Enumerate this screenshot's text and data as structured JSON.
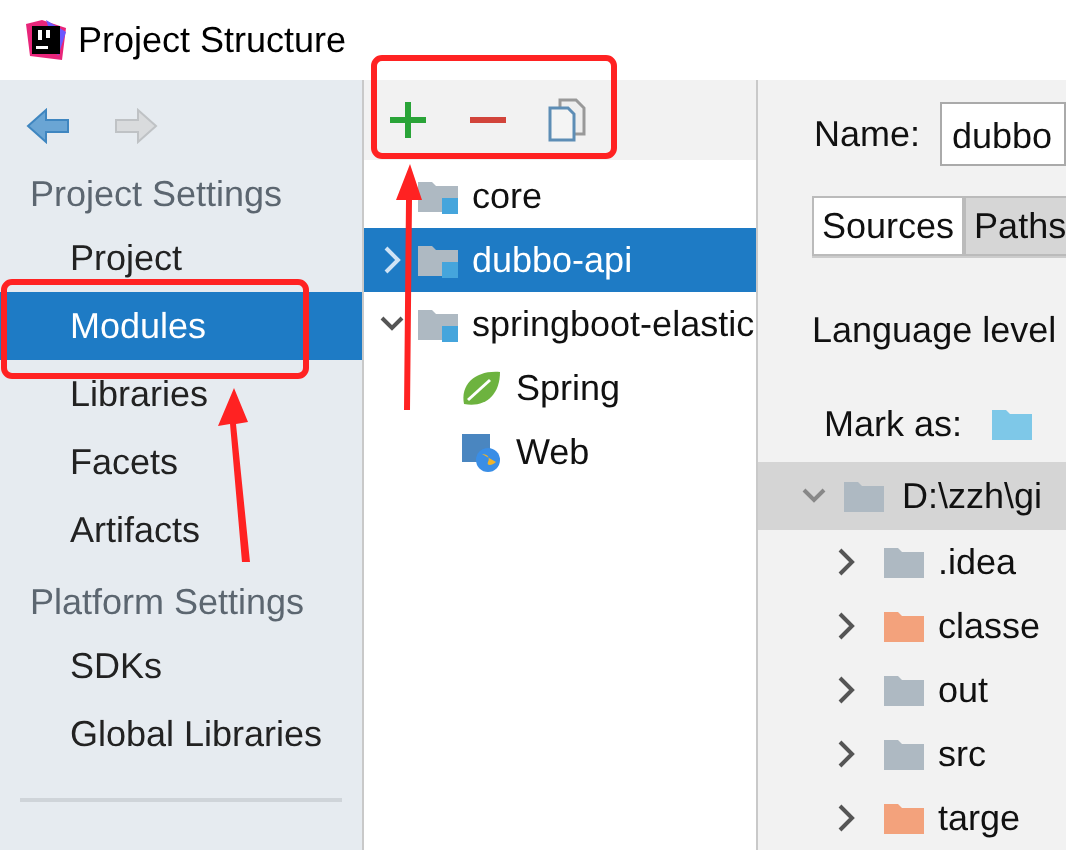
{
  "window": {
    "title": "Project Structure"
  },
  "sidebar": {
    "sections": [
      {
        "title": "Project Settings",
        "items": [
          {
            "label": "Project",
            "selected": false
          },
          {
            "label": "Modules",
            "selected": true
          },
          {
            "label": "Libraries",
            "selected": false
          },
          {
            "label": "Facets",
            "selected": false
          },
          {
            "label": "Artifacts",
            "selected": false
          }
        ]
      },
      {
        "title": "Platform Settings",
        "items": [
          {
            "label": "SDKs",
            "selected": false
          },
          {
            "label": "Global Libraries",
            "selected": false
          }
        ]
      }
    ]
  },
  "module_tree": {
    "items": [
      {
        "label": "core",
        "kind": "module",
        "selected": false
      },
      {
        "label": "dubbo-api",
        "kind": "module",
        "selected": true,
        "expanded": false
      },
      {
        "label": "springboot-elastic",
        "kind": "module",
        "selected": false,
        "expanded": true,
        "children": [
          {
            "label": "Spring",
            "kind": "spring",
            "selected": false
          },
          {
            "label": "Web",
            "kind": "web",
            "selected": false
          }
        ]
      }
    ]
  },
  "detail": {
    "name_label": "Name:",
    "name_value": "dubbo",
    "tabs": [
      {
        "label": "Sources",
        "selected": true
      },
      {
        "label": "Paths",
        "selected": false
      }
    ],
    "language_label": "Language level",
    "mark_label": "Mark as:",
    "content_root": {
      "label": "D:\\zzh\\gi",
      "expanded": true,
      "selected": true,
      "children": [
        {
          "label": ".idea",
          "kind": "plain",
          "expanded": false
        },
        {
          "label": "classe",
          "kind": "excluded",
          "expanded": false
        },
        {
          "label": "out",
          "kind": "plain",
          "expanded": false
        },
        {
          "label": "src",
          "kind": "plain",
          "expanded": false
        },
        {
          "label": "targe",
          "kind": "excluded",
          "expanded": false
        }
      ]
    }
  }
}
